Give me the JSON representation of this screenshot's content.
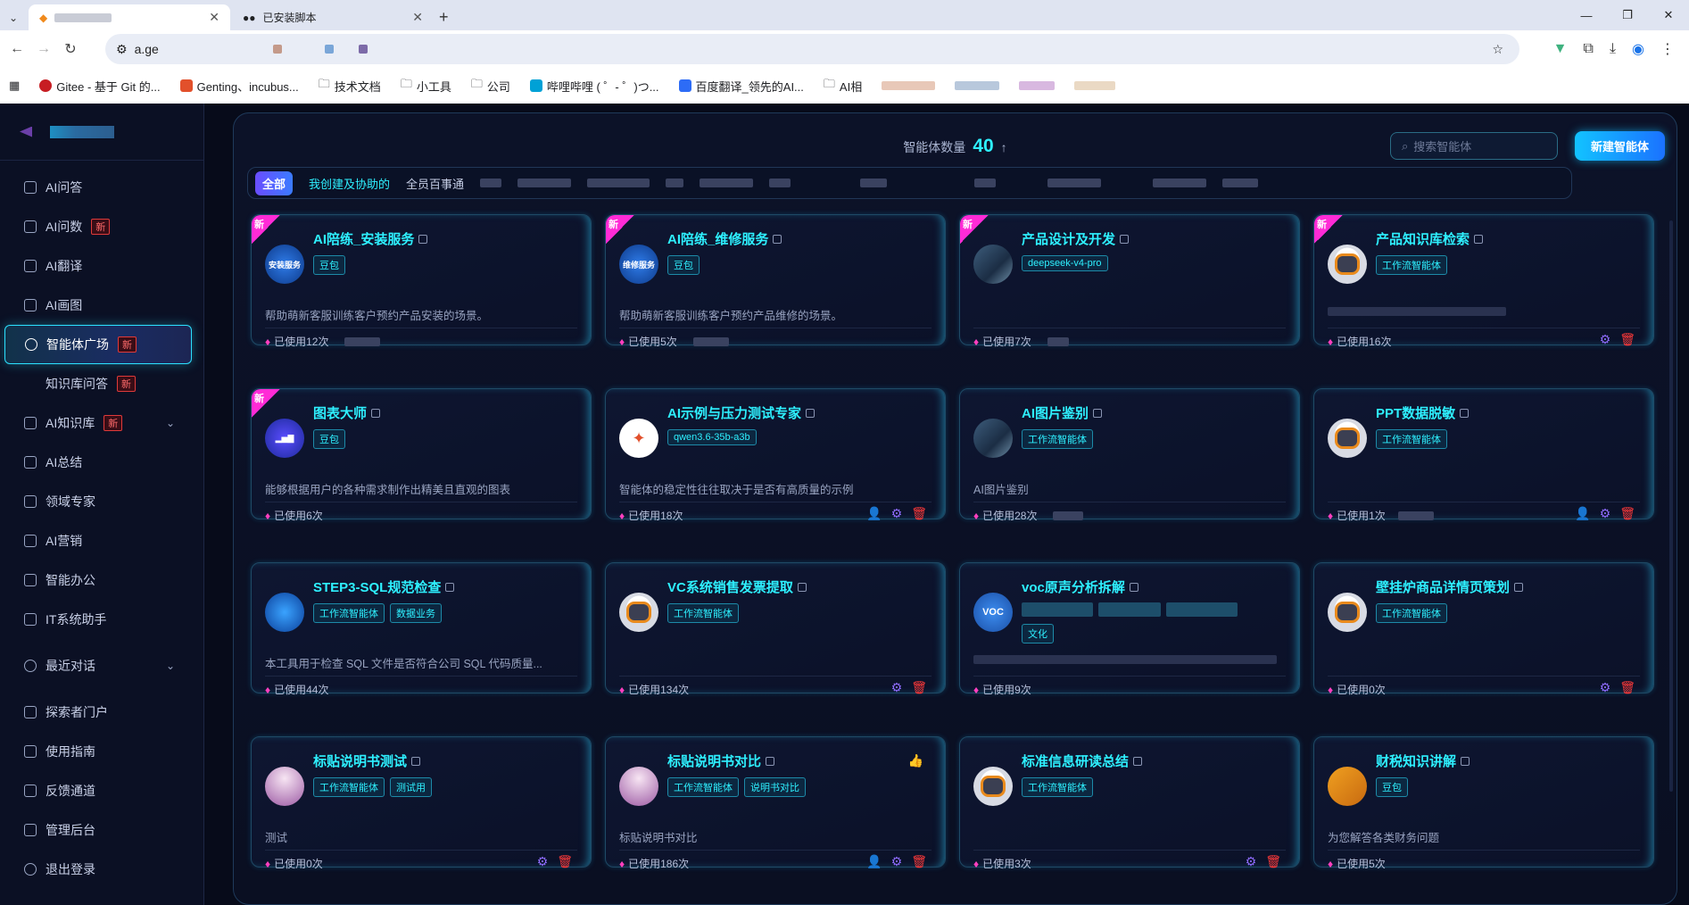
{
  "browser": {
    "tabs": [
      {
        "title": "",
        "active": true
      },
      {
        "title": "已安装脚本",
        "active": false
      }
    ],
    "address": "a.ge",
    "bookmarks": [
      "Gitee - 基于 Git 的...",
      "Genting、incubus...",
      "技术文档",
      "小工具",
      "公司",
      "哔哩哔哩 ( ゜- ゜)つ...",
      "百度翻译_领先的AI...",
      "AI相"
    ]
  },
  "sidebar": {
    "items": [
      {
        "label": "AI问答",
        "badge": ""
      },
      {
        "label": "AI问数",
        "badge": "新"
      },
      {
        "label": "AI翻译",
        "badge": ""
      },
      {
        "label": "AI画图",
        "badge": ""
      },
      {
        "label": "智能体广场",
        "badge": "新"
      },
      {
        "label": "知识库问答",
        "badge": "新"
      },
      {
        "label": "AI知识库",
        "badge": "新"
      },
      {
        "label": "AI总结",
        "badge": ""
      },
      {
        "label": "领域专家",
        "badge": ""
      },
      {
        "label": "AI营销",
        "badge": ""
      },
      {
        "label": "智能办公",
        "badge": ""
      },
      {
        "label": "IT系统助手",
        "badge": ""
      },
      {
        "label": "最近对话",
        "badge": ""
      },
      {
        "label": "探索者门户",
        "badge": ""
      },
      {
        "label": "使用指南",
        "badge": ""
      },
      {
        "label": "反馈通道",
        "badge": ""
      },
      {
        "label": "管理后台",
        "badge": ""
      },
      {
        "label": "退出登录",
        "badge": ""
      }
    ]
  },
  "header": {
    "count_label": "智能体数量",
    "count_value": "40",
    "search_placeholder": "搜索智能体",
    "new_button": "新建智能体"
  },
  "filters": [
    "全部",
    "我创建及协助的",
    "全员百事通"
  ],
  "cards": [
    {
      "title": "AI陪练_安装服务",
      "tags": [
        "豆包"
      ],
      "desc": "帮助萌新客服训练客户预约产品安装的场景。",
      "usage": "已使用12次",
      "new": "新",
      "avatar_text": "安装服务"
    },
    {
      "title": "AI陪练_维修服务",
      "tags": [
        "豆包"
      ],
      "desc": "帮助萌新客服训练客户预约产品维修的场景。",
      "usage": "已使用5次",
      "new": "新",
      "avatar_text": "维修服务"
    },
    {
      "title": "产品设计及开发",
      "tags": [
        "deepseek-v4-pro"
      ],
      "desc": "",
      "usage": "已使用7次",
      "new": "新",
      "avatar_text": ""
    },
    {
      "title": "产品知识库检索",
      "tags": [
        "工作流智能体"
      ],
      "desc": "",
      "usage": "已使用16次",
      "new": "新",
      "avatar_text": ""
    },
    {
      "title": "图表大师",
      "tags": [
        "豆包"
      ],
      "desc": "能够根据用户的各种需求制作出精美且直观的图表",
      "usage": "已使用6次",
      "new": "新",
      "avatar_text": ""
    },
    {
      "title": "AI示例与压力测试专家",
      "tags": [
        "qwen3.6-35b-a3b"
      ],
      "desc": "智能体的稳定性往往取决于是否有高质量的示例",
      "usage": "已使用18次",
      "new": "",
      "avatar_text": ""
    },
    {
      "title": "AI图片鉴别",
      "tags": [
        "工作流智能体"
      ],
      "desc": "AI图片鉴别",
      "usage": "已使用28次",
      "new": "",
      "avatar_text": ""
    },
    {
      "title": "PPT数据脱敏",
      "tags": [
        "工作流智能体"
      ],
      "desc": "",
      "usage": "已使用1次",
      "new": "",
      "avatar_text": ""
    },
    {
      "title": "STEP3-SQL规范检查",
      "tags": [
        "工作流智能体",
        "数据业务"
      ],
      "desc": "本工具用于检查 SQL 文件是否符合公司 SQL 代码质量...",
      "usage": "已使用44次",
      "new": "",
      "avatar_text": ""
    },
    {
      "title": "VC系统销售发票提取",
      "tags": [
        "工作流智能体"
      ],
      "desc": "",
      "usage": "已使用134次",
      "new": "",
      "avatar_text": ""
    },
    {
      "title": "voc原声分析拆解",
      "tags": [
        "文化"
      ],
      "desc": "",
      "usage": "已使用9次",
      "new": "",
      "avatar_text": "VOC"
    },
    {
      "title": "壁挂炉商品详情页策划",
      "tags": [
        "工作流智能体"
      ],
      "desc": "",
      "usage": "已使用0次",
      "new": "",
      "avatar_text": ""
    },
    {
      "title": "标贴说明书测试",
      "tags": [
        "工作流智能体",
        "测试用"
      ],
      "desc": "测试",
      "usage": "已使用0次",
      "new": "",
      "avatar_text": ""
    },
    {
      "title": "标贴说明书对比",
      "tags": [
        "工作流智能体",
        "说明书对比"
      ],
      "desc": "标贴说明书对比",
      "usage": "已使用186次",
      "new": "",
      "avatar_text": ""
    },
    {
      "title": "标准信息研读总结",
      "tags": [
        "工作流智能体"
      ],
      "desc": "",
      "usage": "已使用3次",
      "new": "",
      "avatar_text": ""
    },
    {
      "title": "财税知识讲解",
      "tags": [
        "豆包"
      ],
      "desc": "为您解答各类财务问题",
      "usage": "已使用5次",
      "new": "",
      "avatar_text": ""
    }
  ],
  "icons": {
    "fire": "fire-icon",
    "gear": "gear-icon",
    "delete": "trash-icon",
    "share": "user-share-icon",
    "like": "thumbs-up-icon"
  },
  "colors": {
    "accent": "#2ef0ff",
    "new_ribbon": "#ff2bd6",
    "primary_button": "#12c3ff"
  }
}
